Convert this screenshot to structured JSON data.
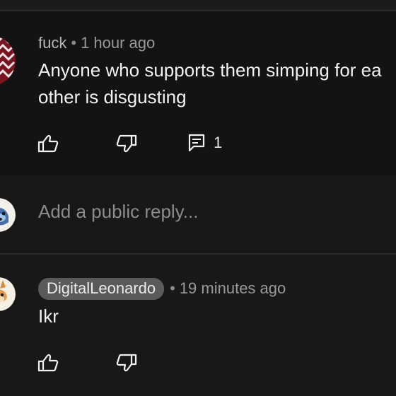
{
  "comment": {
    "author": "fuck",
    "timestamp": "1 hour ago",
    "text_line1": "Anyone who supports them simping for ea",
    "text_line2": "other is disgusting",
    "reply_count": "1"
  },
  "reply_box": {
    "placeholder": "Add a public reply..."
  },
  "reply": {
    "author": "DigitalLeonardo",
    "timestamp": "19 minutes ago",
    "text": "Ikr"
  },
  "separator": "•",
  "icons": {
    "like": "thumbs-up-icon",
    "dislike": "thumbs-down-icon",
    "replies": "comment-icon"
  },
  "colors": {
    "background": "#181818",
    "card": "#131313",
    "text": "#f1f1f1",
    "meta": "#9a9a9a",
    "badge": "#5a5a5a"
  }
}
